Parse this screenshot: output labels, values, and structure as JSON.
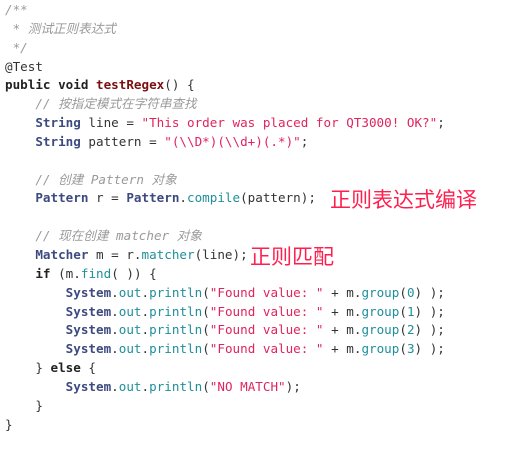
{
  "colors": {
    "string": "#e0245e",
    "annotation": "#ff1f4f",
    "comment": "#9a9a9a",
    "type": "#3c4a80",
    "method": "#1f8f9a"
  },
  "code_lines": [
    [
      [
        "cm",
        "/**"
      ]
    ],
    [
      [
        "cm",
        " * 测试正则表达式"
      ]
    ],
    [
      [
        "cm",
        " */"
      ]
    ],
    [
      [
        "an",
        "@Test"
      ]
    ],
    [
      [
        "kw",
        "public void "
      ],
      [
        "fn",
        "testRegex"
      ],
      [
        "pl",
        "() {"
      ]
    ],
    [
      [
        "cm",
        "    // 按指定模式在字符串查找"
      ]
    ],
    [
      [
        "pl",
        "    "
      ],
      [
        "ty",
        "String"
      ],
      [
        "pl",
        " line = "
      ],
      [
        "st",
        "\"This order was placed for QT3000! OK?\""
      ],
      [
        "pl",
        ";"
      ]
    ],
    [
      [
        "pl",
        "    "
      ],
      [
        "ty",
        "String"
      ],
      [
        "pl",
        " pattern = "
      ],
      [
        "st",
        "\"(\\\\D*)(\\\\d+)(.*)\""
      ],
      [
        "pl",
        ";"
      ]
    ],
    [],
    [
      [
        "cm",
        "    // 创建 Pattern 对象"
      ]
    ],
    [
      [
        "pl",
        "    "
      ],
      [
        "ty",
        "Pattern"
      ],
      [
        "pl",
        " r = "
      ],
      [
        "ty",
        "Pattern"
      ],
      [
        "pl",
        "."
      ],
      [
        "me",
        "compile"
      ],
      [
        "pl",
        "(pattern);"
      ]
    ],
    [],
    [
      [
        "cm",
        "    // 现在创建 matcher 对象"
      ]
    ],
    [
      [
        "pl",
        "    "
      ],
      [
        "ty",
        "Matcher"
      ],
      [
        "pl",
        " m = r."
      ],
      [
        "me",
        "matcher"
      ],
      [
        "pl",
        "(line);"
      ]
    ],
    [
      [
        "pl",
        "    "
      ],
      [
        "kw",
        "if"
      ],
      [
        "pl",
        " (m."
      ],
      [
        "me",
        "find"
      ],
      [
        "pl",
        "( )) {"
      ]
    ],
    [
      [
        "pl",
        "        "
      ],
      [
        "ty",
        "System"
      ],
      [
        "pl",
        "."
      ],
      [
        "me",
        "out"
      ],
      [
        "pl",
        "."
      ],
      [
        "me",
        "println"
      ],
      [
        "pl",
        "("
      ],
      [
        "st",
        "\"Found value: \""
      ],
      [
        "pl",
        " + m."
      ],
      [
        "me",
        "group"
      ],
      [
        "pl",
        "("
      ],
      [
        "nu",
        "0"
      ],
      [
        "pl",
        ") );"
      ]
    ],
    [
      [
        "pl",
        "        "
      ],
      [
        "ty",
        "System"
      ],
      [
        "pl",
        "."
      ],
      [
        "me",
        "out"
      ],
      [
        "pl",
        "."
      ],
      [
        "me",
        "println"
      ],
      [
        "pl",
        "("
      ],
      [
        "st",
        "\"Found value: \""
      ],
      [
        "pl",
        " + m."
      ],
      [
        "me",
        "group"
      ],
      [
        "pl",
        "("
      ],
      [
        "nu",
        "1"
      ],
      [
        "pl",
        ") );"
      ]
    ],
    [
      [
        "pl",
        "        "
      ],
      [
        "ty",
        "System"
      ],
      [
        "pl",
        "."
      ],
      [
        "me",
        "out"
      ],
      [
        "pl",
        "."
      ],
      [
        "me",
        "println"
      ],
      [
        "pl",
        "("
      ],
      [
        "st",
        "\"Found value: \""
      ],
      [
        "pl",
        " + m."
      ],
      [
        "me",
        "group"
      ],
      [
        "pl",
        "("
      ],
      [
        "nu",
        "2"
      ],
      [
        "pl",
        ") );"
      ]
    ],
    [
      [
        "pl",
        "        "
      ],
      [
        "ty",
        "System"
      ],
      [
        "pl",
        "."
      ],
      [
        "me",
        "out"
      ],
      [
        "pl",
        "."
      ],
      [
        "me",
        "println"
      ],
      [
        "pl",
        "("
      ],
      [
        "st",
        "\"Found value: \""
      ],
      [
        "pl",
        " + m."
      ],
      [
        "me",
        "group"
      ],
      [
        "pl",
        "("
      ],
      [
        "nu",
        "3"
      ],
      [
        "pl",
        ") );"
      ]
    ],
    [
      [
        "pl",
        "    } "
      ],
      [
        "kw",
        "else"
      ],
      [
        "pl",
        " {"
      ]
    ],
    [
      [
        "pl",
        "        "
      ],
      [
        "ty",
        "System"
      ],
      [
        "pl",
        "."
      ],
      [
        "me",
        "out"
      ],
      [
        "pl",
        "."
      ],
      [
        "me",
        "println"
      ],
      [
        "pl",
        "("
      ],
      [
        "st",
        "\"NO MATCH\""
      ],
      [
        "pl",
        ");"
      ]
    ],
    [
      [
        "pl",
        "    }"
      ]
    ],
    [
      [
        "pl",
        "}"
      ]
    ]
  ],
  "annotations": {
    "compile_note": "正则表达式编译",
    "match_note": "正则匹配"
  }
}
